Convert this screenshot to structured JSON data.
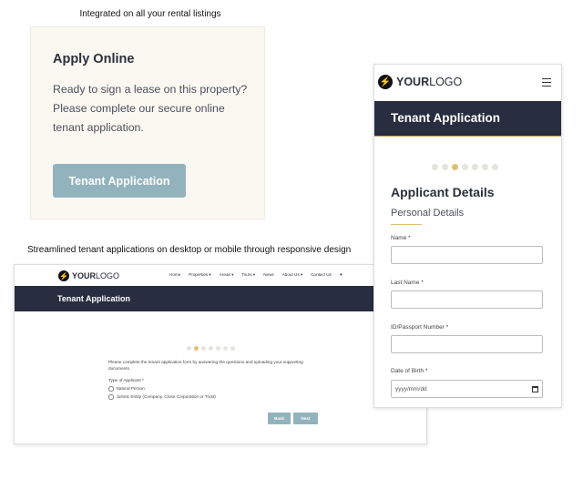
{
  "captions": {
    "top": "Integrated on all your rental listings",
    "middle": "Streamlined tenant applications on desktop or mobile through responsive design"
  },
  "apply_card": {
    "title": "Apply Online",
    "text": "Ready to sign a lease on this property? Please complete our secure online tenant application.",
    "button": "Tenant Application"
  },
  "logo": {
    "bold": "YOUR",
    "light": "LOGO"
  },
  "desktop": {
    "nav": [
      "Home",
      "Properties ▾",
      "Areas ▾",
      "Tours ▾",
      "News",
      "About Us ▾",
      "Contact Us",
      "♥"
    ],
    "banner_title": "Tenant Application",
    "progress": {
      "steps": 7,
      "active_step": 2
    },
    "intro": "Please complete the tenant application form by answering the questions and uploading your supporting documents.",
    "type_label": "Type of Applicant *",
    "options": [
      "Natural Person",
      "Juristic Entity (Company, Close Corporation or Trust)"
    ],
    "back_label": "Back",
    "next_label": "Next"
  },
  "mobile": {
    "banner_title": "Tenant Application",
    "progress": {
      "steps": 7,
      "active_step": 3
    },
    "heading": "Applicant Details",
    "subheading": "Personal Details",
    "fields": {
      "name": "Name *",
      "last_name": "Last Name *",
      "id": "ID/Passport Number *",
      "dob": "Date of Birth *",
      "dob_placeholder": "yyyy/mm/dd"
    }
  },
  "colors": {
    "navy": "#282d3f",
    "button": "#92b3bd",
    "accent": "#e2bf73",
    "card_bg": "#faf8f1"
  }
}
